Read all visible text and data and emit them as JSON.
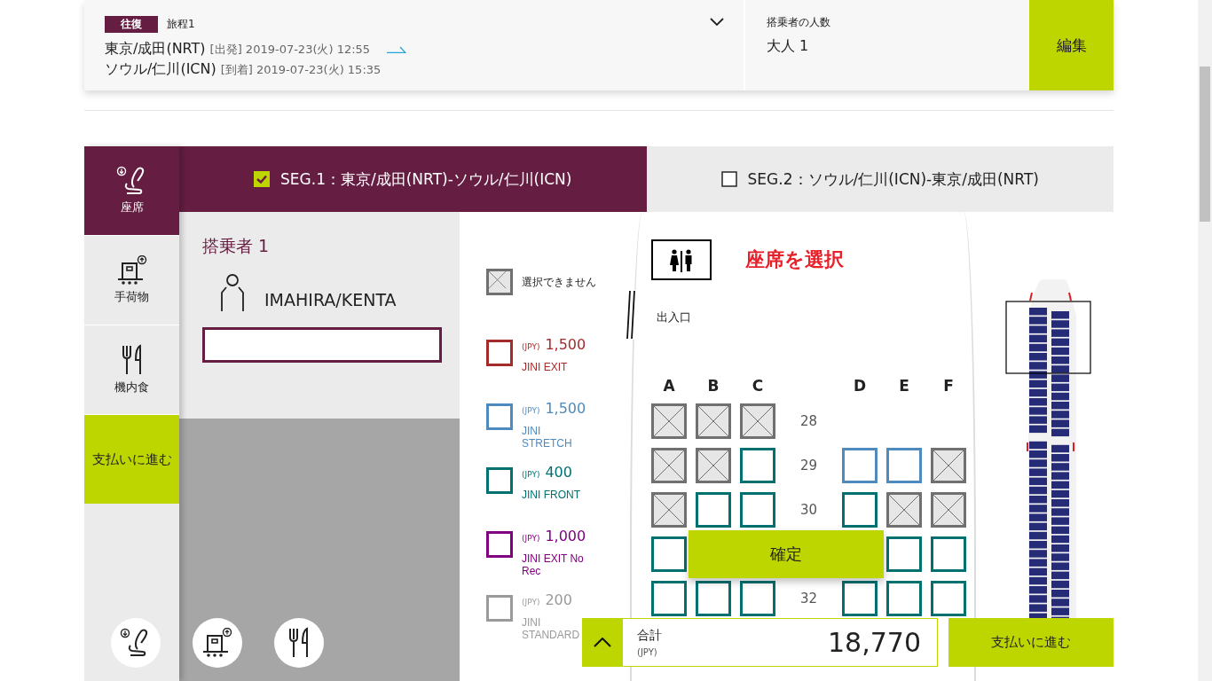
{
  "trip": {
    "badge": "往復",
    "itinerary": "旅程1",
    "from": "東京/成田(NRT)",
    "dep_label": "[出発]",
    "dep_time": "2019-07-23(火) 12:55",
    "to": "ソウル/仁川(ICN)",
    "arr_label": "[到着]",
    "arr_time": "2019-07-23(火) 15:35"
  },
  "passengers": {
    "label": "搭乗者の人数",
    "value": "大人 1"
  },
  "edit_button": "編集",
  "sidebar": [
    {
      "label": "座席",
      "kind": "seat",
      "selected": true
    },
    {
      "label": "手荷物",
      "kind": "baggage",
      "selected": false
    },
    {
      "label": "機内食",
      "kind": "meal",
      "selected": false
    }
  ],
  "sidebar_pay": "支払いに進む",
  "segments": [
    {
      "label": "SEG.1：東京/成田(NRT)-ソウル/仁川(ICN)",
      "selected": true
    },
    {
      "label": "SEG.2：ソウル/仁川(ICN)-東京/成田(NRT)",
      "selected": false
    }
  ],
  "passenger": {
    "title": "搭乗者 1",
    "name": "IMAHIRA/KENTA"
  },
  "legend": [
    {
      "kind": "unavailable",
      "label": "選択できません"
    },
    {
      "kind": "exit",
      "currency": "(JPY)",
      "price": "1,500",
      "label": "JINI EXIT",
      "color": "#a52a2a"
    },
    {
      "kind": "stretch",
      "currency": "(JPY)",
      "price": "1,500",
      "label": "JINI STRETCH",
      "color": "#4f8abf"
    },
    {
      "kind": "front",
      "currency": "(JPY)",
      "price": "400",
      "label": "JINI FRONT",
      "color": "#007070"
    },
    {
      "kind": "exit_norec",
      "currency": "(JPY)",
      "price": "1,000",
      "label": "JINI EXIT No Rec",
      "color": "#800080"
    },
    {
      "kind": "standard",
      "currency": "(JPY)",
      "price": "200",
      "label": "JINI STANDARD",
      "color": "#9a9a9a"
    }
  ],
  "seatmap": {
    "title": "座席を選択",
    "exit_label": "出入口",
    "columns": [
      "A",
      "B",
      "C",
      "D",
      "E",
      "F"
    ],
    "rows": [
      {
        "number": "28",
        "seats": [
          {
            "kind": "unavailable"
          },
          {
            "kind": "unavailable"
          },
          {
            "kind": "unavailable"
          },
          {
            "kind": "none"
          },
          {
            "kind": "none"
          },
          {
            "kind": "none"
          }
        ]
      },
      {
        "number": "29",
        "seats": [
          {
            "kind": "unavailable"
          },
          {
            "kind": "unavailable"
          },
          {
            "kind": "front"
          },
          {
            "kind": "stretch"
          },
          {
            "kind": "stretch"
          },
          {
            "kind": "unavailable"
          }
        ]
      },
      {
        "number": "30",
        "seats": [
          {
            "kind": "unavailable"
          },
          {
            "kind": "front"
          },
          {
            "kind": "front"
          },
          {
            "kind": "front"
          },
          {
            "kind": "unavailable"
          },
          {
            "kind": "unavailable"
          }
        ]
      },
      {
        "seats": [
          {
            "kind": "front"
          },
          {
            "kind": "none"
          },
          {
            "kind": "none"
          },
          {
            "kind": "none"
          },
          {
            "kind": "front"
          },
          {
            "kind": "front"
          }
        ]
      },
      {
        "number": "32",
        "seats": [
          {
            "kind": "front"
          },
          {
            "kind": "front"
          },
          {
            "kind": "front"
          },
          {
            "kind": "front"
          },
          {
            "kind": "front"
          },
          {
            "kind": "front"
          }
        ]
      }
    ]
  },
  "confirm_button": "確定",
  "total": {
    "label": "合計",
    "currency": "(JPY)",
    "amount": "18,770"
  },
  "pay_button": "支払いに進む"
}
